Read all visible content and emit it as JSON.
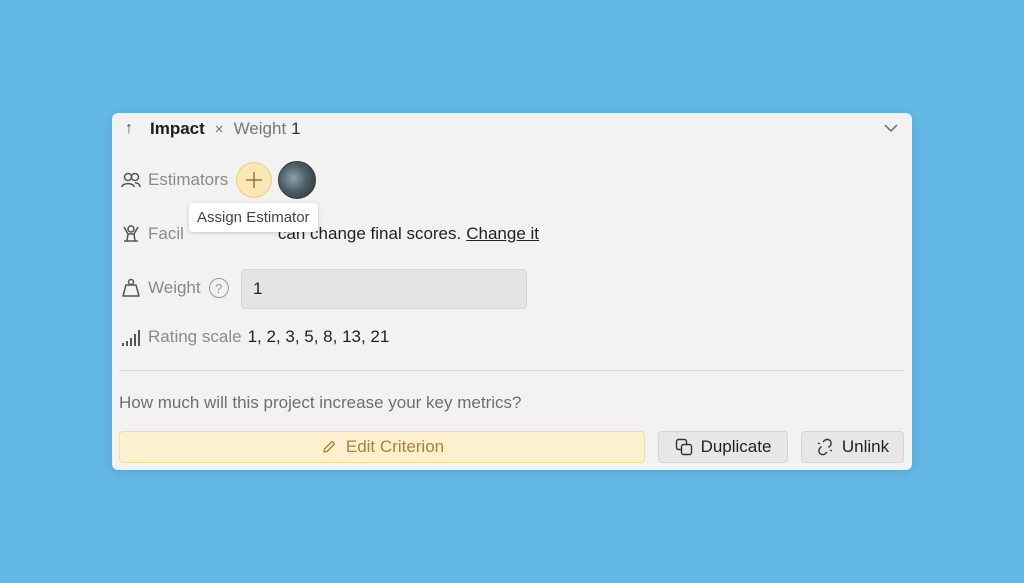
{
  "header": {
    "title": "Impact",
    "separator": "×",
    "weight_label": "Weight",
    "weight_value": "1"
  },
  "estimators": {
    "label": "Estimators",
    "tooltip": "Assign Estimator"
  },
  "facilitator": {
    "label_partial": "Facil",
    "text": "can change final scores.",
    "link": "Change it"
  },
  "weight": {
    "label": "Weight",
    "help": "?",
    "value": "1"
  },
  "rating": {
    "label": "Rating scale",
    "values": "1, 2, 3, 5, 8, 13, 21"
  },
  "description": "How much will this project increase your key metrics?",
  "buttons": {
    "edit": "Edit Criterion",
    "duplicate": "Duplicate",
    "unlink": "Unlink"
  },
  "colors": {
    "background": "#63b8e6",
    "card": "#f2f2f2",
    "accent": "#fbe6b5"
  }
}
